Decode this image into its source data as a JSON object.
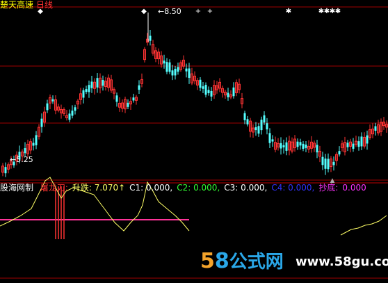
{
  "header": {
    "title": "楚天高速",
    "period": "日线"
  },
  "price": {
    "high_label": "8.50",
    "low_label": "5.25"
  },
  "indicator": {
    "name": "股海网制",
    "items": [
      {
        "label": "屠龙刀:",
        "color": "#ff3333"
      },
      {
        "label": "升跌: 7.070↑",
        "color": "#ffff66"
      },
      {
        "label": "C1: 0.000,",
        "color": "#ffffff"
      },
      {
        "label": "C2: 0.000,",
        "color": "#33ff33"
      },
      {
        "label": "C3: 0.000,",
        "color": "#ffffff"
      },
      {
        "label": "C4: 0.000,",
        "color": "#3333ff"
      },
      {
        "label": "抄底:",
        "color": "#ff33ff"
      },
      {
        "label": "0.000",
        "color": "#ff33ff"
      }
    ]
  },
  "watermark": {
    "digit5": "5",
    "digit8": "8",
    "cn": "公式网",
    "url": "www.58gu.com"
  },
  "colors": {
    "up": "#ff3333",
    "down": "#54ffff",
    "grid": "#a00000",
    "line": "#ffff66",
    "pink": "#ff3399"
  }
}
